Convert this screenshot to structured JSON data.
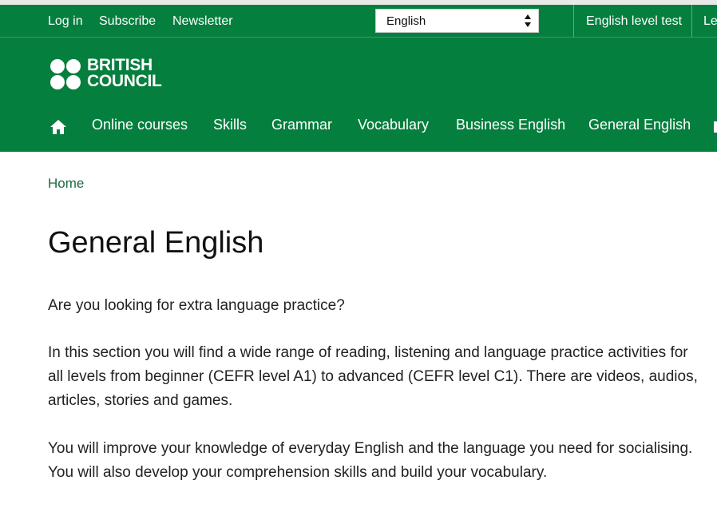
{
  "utility": {
    "login": "Log in",
    "subscribe": "Subscribe",
    "newsletter": "Newsletter",
    "language_selected": "English",
    "level_test": "English level test",
    "cut_link": "Le"
  },
  "logo": {
    "line1": "BRITISH",
    "line2": "COUNCIL"
  },
  "nav": {
    "home_icon": "home-icon",
    "items": [
      "Online courses",
      "Skills",
      "Grammar",
      "Vocabulary",
      "Business English",
      "General English"
    ]
  },
  "breadcrumb": {
    "home": "Home"
  },
  "main": {
    "title": "General English",
    "paragraphs": [
      "Are you looking for extra language practice?",
      "In this section you will find a wide range of reading, listening and language practice activities for all levels from beginner (CEFR level A1) to advanced (CEFR level C1). There are videos, audios, articles, stories and games.",
      "You will improve your knowledge of everyday English and the language you need for socialising. You will also develop your comprehension skills and build your vocabulary."
    ]
  },
  "colors": {
    "brand_green": "#057f3e",
    "link_green": "#1c6a3f",
    "text": "#222222"
  }
}
